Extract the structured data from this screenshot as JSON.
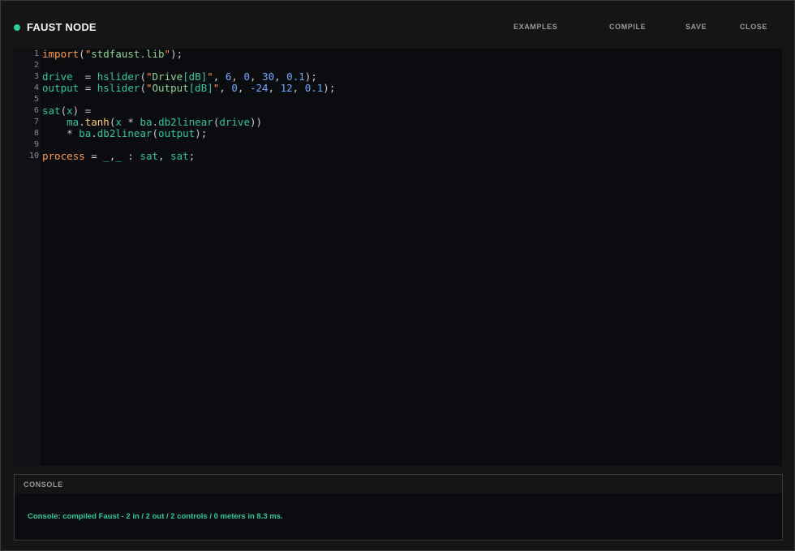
{
  "header": {
    "title": "FAUST NODE",
    "status_color": "#2ec99b",
    "buttons": {
      "examples": "EXAMPLES",
      "compile": "COMPILE",
      "save": "SAVE",
      "close": "CLOSE"
    }
  },
  "editor": {
    "language": "faust",
    "lines": [
      {
        "n": "1",
        "text": "import(\"stdfaust.lib\");"
      },
      {
        "n": "2",
        "text": ""
      },
      {
        "n": "3",
        "text": "drive  = hslider(\"Drive[dB]\", 6, 0, 30, 0.1);"
      },
      {
        "n": "4",
        "text": "output = hslider(\"Output[dB]\", 0, -24, 12, 0.1);"
      },
      {
        "n": "5",
        "text": ""
      },
      {
        "n": "6",
        "text": "sat(x) ="
      },
      {
        "n": "7",
        "text": "    ma.tanh(x * ba.db2linear(drive))"
      },
      {
        "n": "8",
        "text": "    * ba.db2linear(output);"
      },
      {
        "n": "9",
        "text": ""
      },
      {
        "n": "10",
        "text": "process = _,_ : sat, sat;"
      }
    ]
  },
  "console": {
    "title": "CONSOLE",
    "message": "Console: compiled Faust - 2 in / 2 out / 2 controls / 0 meters in 8.3 ms."
  }
}
